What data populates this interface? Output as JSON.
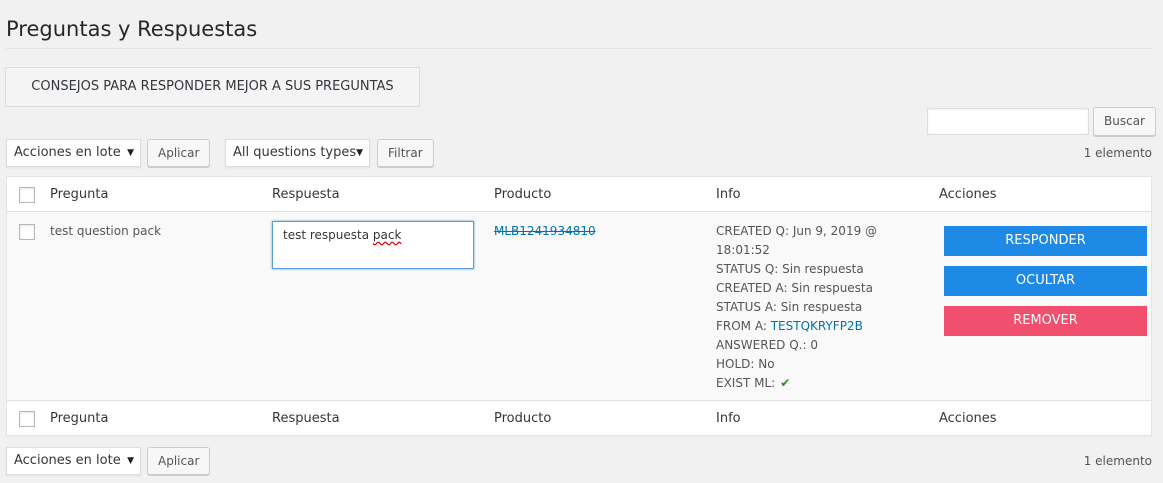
{
  "page": {
    "title": "Preguntas y Respuestas"
  },
  "tips": {
    "label": "CONSEJOS PARA RESPONDER MEJOR A SUS PREGUNTAS"
  },
  "search": {
    "value": "",
    "placeholder": "",
    "button_label": "Buscar"
  },
  "bulk_top": {
    "selected": "Acciones en lote",
    "apply_label": "Aplicar"
  },
  "filter": {
    "selected": "All questions types",
    "button_label": "Filtrar"
  },
  "count_label": "1 elemento",
  "columns": {
    "question": "Pregunta",
    "answer": "Respuesta",
    "product": "Producto",
    "info": "Info",
    "actions": "Acciones"
  },
  "rows": [
    {
      "question": "test question pack",
      "answer_prefix": "test respuesta ",
      "answer_misspelled": "pack",
      "product": "MLB1241934810",
      "info": {
        "created_q": "CREATED Q: Jun 9, 2019 @",
        "created_q_time": "18:01:52",
        "status_q": "STATUS Q: Sin respuesta",
        "created_a": "CREATED A: Sin respuesta",
        "status_a": "STATUS A: Sin respuesta",
        "from_a_label": "FROM A: ",
        "from_a_user": "TESTQKRYFP2B",
        "answered_q": "ANSWERED Q.: 0",
        "hold": "HOLD: No",
        "exist_ml": "EXIST ML:"
      },
      "actions": {
        "respond": "RESPONDER",
        "hide": "OCULTAR",
        "remove": "REMOVER"
      }
    }
  ],
  "bulk_bottom": {
    "selected": "Acciones en lote",
    "apply_label": "Aplicar"
  },
  "colors": {
    "respond": "#1e8ae6",
    "hide": "#1e8ae6",
    "remove": "#f0506e",
    "link": "#0073aa",
    "check": "#2e8b1e"
  },
  "icons": {
    "exist_ml": "checkmark-icon",
    "select_caret": "caret-down-icon"
  }
}
